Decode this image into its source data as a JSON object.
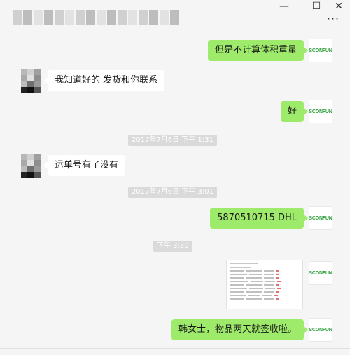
{
  "window": {
    "minimize_icon": "—",
    "maximize_icon": "☐",
    "close_icon": "✕",
    "more_icon": "···"
  },
  "avatar": {
    "self_label": "SCONFUN"
  },
  "messages": [
    {
      "text": "但是不计算体积重量"
    },
    {
      "text": "我知道好的 发货和你联系"
    },
    {
      "text": "好"
    },
    {
      "text": "运单号有了没有"
    },
    {
      "text": "5870510715  DHL"
    },
    {
      "text": "韩女士，物品两天就签收啦。"
    }
  ],
  "timestamps": [
    "2017年7月6日 下午 1:31",
    "2017年7月6日 下午 3:01",
    "下午 3:30"
  ]
}
